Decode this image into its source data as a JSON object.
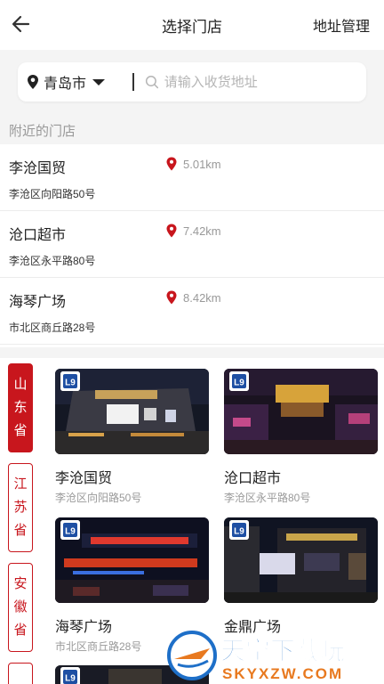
{
  "nav": {
    "title": "选择门店",
    "right_action": "地址管理"
  },
  "search": {
    "city": "青岛市",
    "placeholder": "请输入收货地址"
  },
  "nearby": {
    "header": "附近的门店",
    "stores": [
      {
        "name": "李沧国贸",
        "distance": "5.01km",
        "address": "李沧区向阳路50号"
      },
      {
        "name": "沧口超市",
        "distance": "7.42km",
        "address": "李沧区永平路80号"
      },
      {
        "name": "海琴广场",
        "distance": "8.42km",
        "address": "市北区商丘路28号"
      }
    ]
  },
  "provinces": [
    {
      "label": "山东省",
      "active": true
    },
    {
      "label": "江苏省",
      "active": false
    },
    {
      "label": "安徽省",
      "active": false
    }
  ],
  "store_cards": [
    {
      "name": "李沧国贸",
      "address": "李沧区向阳路50号"
    },
    {
      "name": "沧口超市",
      "address": "李沧区永平路80号"
    },
    {
      "name": "海琴广场",
      "address": "市北区商丘路28号"
    },
    {
      "name": "金鼎广场",
      "address": ""
    }
  ],
  "watermark": {
    "main": "天空下载玩",
    "sub": "SKYXZW.COM"
  },
  "colors": {
    "accent": "#c8161d",
    "brand_logo": "#1e4fa3"
  }
}
